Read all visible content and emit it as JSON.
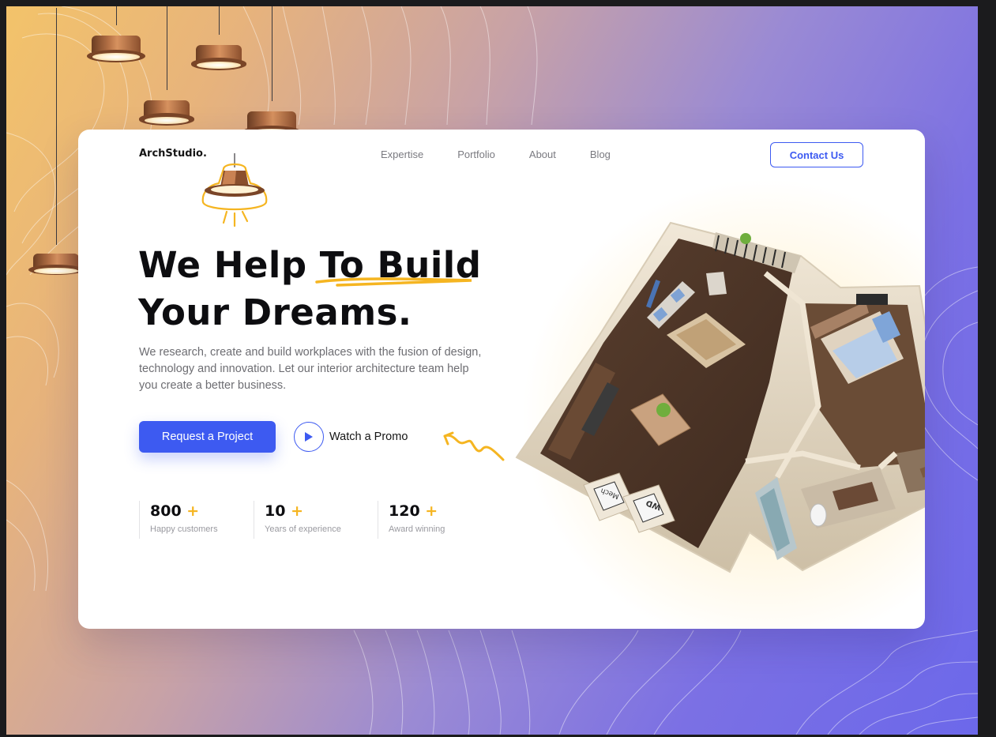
{
  "brand": {
    "logo": "ArchStudio."
  },
  "nav": {
    "items": [
      "Expertise",
      "Portfolio",
      "About",
      "Blog"
    ],
    "contact_label": "Contact Us"
  },
  "hero": {
    "headline_part1": "We Help ",
    "headline_highlight": "To Build",
    "headline_line2": "Your Dreams.",
    "description": "We research, create and build workplaces with the fusion of design, technology and innovation. Let our interior architecture team help you create a better business.",
    "primary_cta": "Request a Project",
    "secondary_cta": "Watch a Promo"
  },
  "stats": [
    {
      "value": "800",
      "plus": "+",
      "label": "Happy customers"
    },
    {
      "value": "10",
      "plus": "+",
      "label": "Years of experience"
    },
    {
      "value": "120",
      "plus": "+",
      "label": "Award winning"
    }
  ],
  "floorplan_labels": {
    "box1": "Mech",
    "box2": "WD"
  },
  "colors": {
    "accent": "#3d5af1",
    "highlight": "#f5b521",
    "text": "#0d0d10"
  },
  "icons": [
    "play-icon",
    "lamp-icon",
    "underline-scribble",
    "arrow-squiggle-icon"
  ]
}
